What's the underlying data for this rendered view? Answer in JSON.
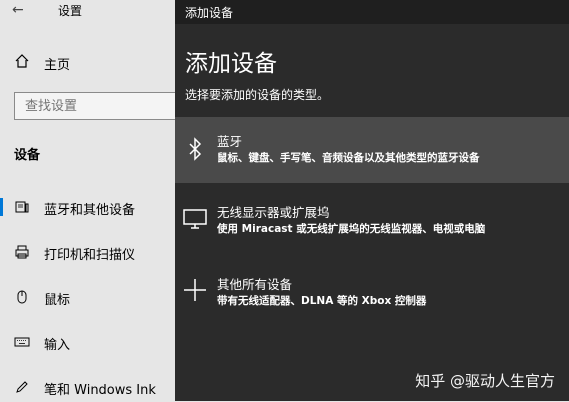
{
  "settings": {
    "title": "设置",
    "home_label": "主页",
    "search_placeholder": "查找设置",
    "section_title": "设备",
    "nav_items": [
      {
        "label": "蓝牙和其他设备",
        "icon": "bluetooth-devices-icon"
      },
      {
        "label": "打印机和扫描仪",
        "icon": "printer-icon"
      },
      {
        "label": "鼠标",
        "icon": "mouse-icon"
      },
      {
        "label": "输入",
        "icon": "keyboard-icon"
      },
      {
        "label": "笔和 Windows Ink",
        "icon": "pen-icon"
      }
    ]
  },
  "dialog": {
    "titlebar": "添加设备",
    "heading": "添加设备",
    "subtitle": "选择要添加的设备的类型。",
    "options": [
      {
        "title": "蓝牙",
        "desc": "鼠标、键盘、手写笔、音频设备以及其他类型的蓝牙设备",
        "icon": "bluetooth-icon"
      },
      {
        "title": "无线显示器或扩展坞",
        "desc": "使用 Miracast 或无线扩展坞的无线监视器、电视或电脑",
        "icon": "monitor-icon"
      },
      {
        "title": "其他所有设备",
        "desc": "带有无线适配器、DLNA 等的 Xbox 控制器",
        "icon": "plus-icon"
      }
    ]
  },
  "watermark": "知乎 @驱动人生官方",
  "colors": {
    "accent": "#0078d7",
    "dialog_bg": "#2b2b2b",
    "selected_bg": "#4a4a4a"
  }
}
